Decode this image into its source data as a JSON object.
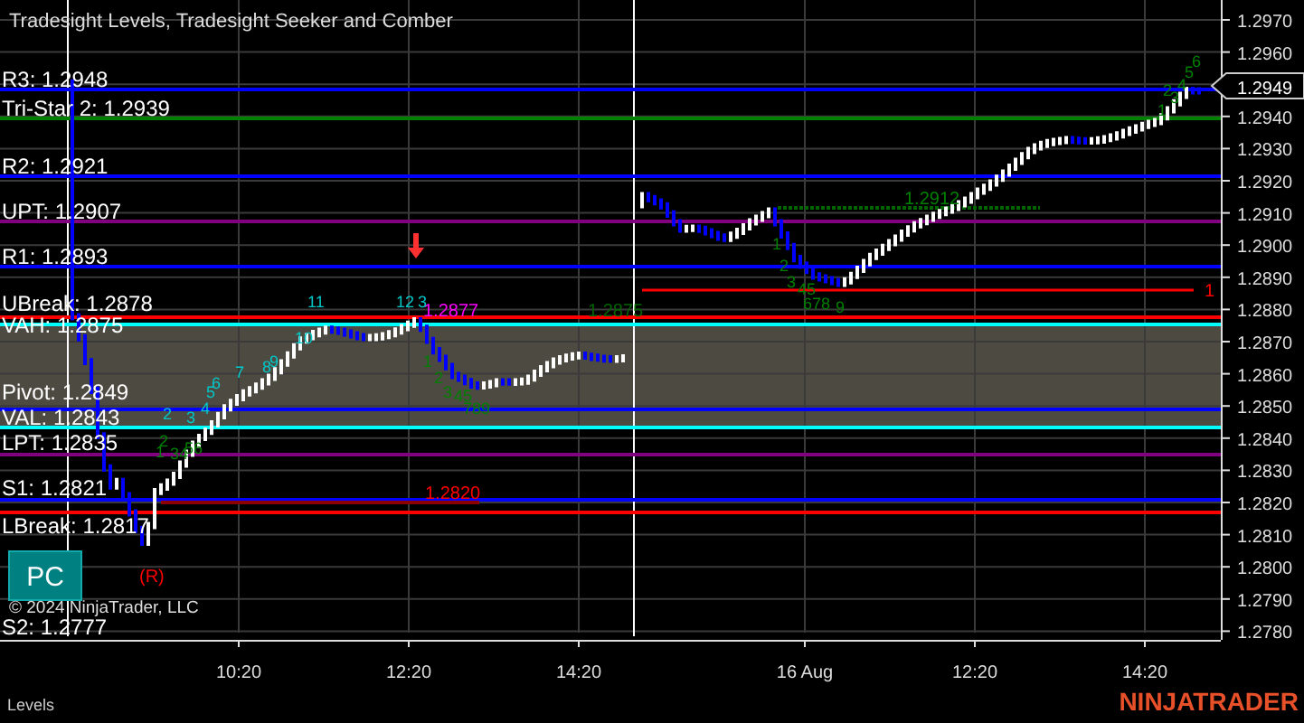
{
  "title": "Tradesight Levels, Tradesight Seeker and Comber",
  "levels": [
    {
      "label": "R3: 1.2948",
      "color": "#0000ff"
    },
    {
      "label": "Tri-Star 2: 1.2939",
      "color": "#008000"
    },
    {
      "label": "R2: 1.2921",
      "color": "#0000ff"
    },
    {
      "label": "UPT: 1.2907",
      "color": "#800080"
    },
    {
      "label": "R1: 1.2893",
      "color": "#0000ff"
    },
    {
      "label": "UBreak: 1.2878",
      "color": "#ff0000"
    },
    {
      "label": "VAH: 1.2875",
      "color": "#00ffff"
    },
    {
      "label": "Pivot: 1.2849",
      "color": "#0000ff"
    },
    {
      "label": "VAL: 1.2843",
      "color": "#00ffff"
    },
    {
      "label": "LPT: 1.2835",
      "color": "#800080"
    },
    {
      "label": "S1: 1.2821",
      "color": "#0000ff"
    },
    {
      "label": "LBreak: 1.2817",
      "color": "#ff0000"
    },
    {
      "label": "S2: 1.2777"
    }
  ],
  "price_axis": [
    "1.2970",
    "1.2960",
    "1.2940",
    "1.2930",
    "1.2920",
    "1.2910",
    "1.2900",
    "1.2890",
    "1.2880",
    "1.2870",
    "1.2860",
    "1.2850",
    "1.2840",
    "1.2830",
    "1.2820",
    "1.2810",
    "1.2800",
    "1.2790",
    "1.2780"
  ],
  "current_price": "1.2949",
  "time_axis": [
    "10:20",
    "12:20",
    "14:20",
    "16 Aug",
    "12:20",
    "14:20"
  ],
  "annotations": [
    {
      "text": "1.2877",
      "color": "#ff00ff"
    },
    {
      "text": "1.2875",
      "color": "#006400"
    },
    {
      "text": "1.2820",
      "color": "#ff0000"
    },
    {
      "text": "1.2912",
      "color": "#008000"
    },
    {
      "text": "1",
      "color": "#ff0000"
    },
    {
      "text": "(R)",
      "color": "#ff0000"
    }
  ],
  "counts": [
    {
      "text": "11",
      "color": "#00c8c8"
    },
    {
      "text": "12",
      "color": "#00c8c8"
    },
    {
      "text": "3",
      "color": "#00c8c8"
    },
    {
      "text": "10",
      "color": "#00c8c8"
    },
    {
      "text": "8",
      "color": "#00c8c8"
    },
    {
      "text": "9",
      "color": "#00c8c8"
    },
    {
      "text": "7",
      "color": "#00c8c8"
    },
    {
      "text": "5",
      "color": "#00c8c8"
    },
    {
      "text": "6",
      "color": "#00c8c8"
    },
    {
      "text": "4",
      "color": "#00c8c8"
    },
    {
      "text": "3",
      "color": "#00c8c8"
    },
    {
      "text": "2",
      "color": "#00c8c8"
    },
    {
      "text": "2",
      "color": "#008000"
    },
    {
      "text": "1",
      "color": "#008000"
    },
    {
      "text": "34",
      "color": "#008000"
    },
    {
      "text": "56",
      "color": "#008000"
    },
    {
      "text": "1",
      "color": "#008000"
    },
    {
      "text": "2",
      "color": "#008000"
    },
    {
      "text": "3",
      "color": "#008000"
    },
    {
      "text": "45",
      "color": "#008000"
    },
    {
      "text": "789",
      "color": "#008000"
    },
    {
      "text": "1",
      "color": "#008000"
    },
    {
      "text": "2",
      "color": "#008000"
    },
    {
      "text": "3",
      "color": "#008000"
    },
    {
      "text": "45",
      "color": "#008000"
    },
    {
      "text": "678",
      "color": "#008000"
    },
    {
      "text": "9",
      "color": "#008000"
    },
    {
      "text": "1",
      "color": "#008000"
    },
    {
      "text": "2",
      "color": "#008000"
    },
    {
      "text": "3",
      "color": "#008000"
    },
    {
      "text": "4",
      "color": "#008000"
    },
    {
      "text": "5",
      "color": "#008000"
    },
    {
      "text": "6",
      "color": "#008000"
    }
  ],
  "pc_button": "PC",
  "copyright": "© 2024 NinjaTrader, LLC",
  "indicator_panel": "Levels",
  "logo": "NINJATRADER"
}
